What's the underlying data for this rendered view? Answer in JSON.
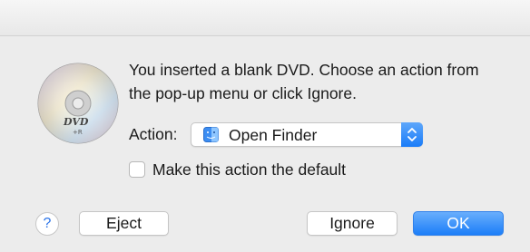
{
  "dialog": {
    "message": "You inserted a blank DVD. Choose an action from the pop-up menu or click Ignore.",
    "disc_label": "DVD",
    "disc_sublabel": "+R",
    "action_label": "Action:",
    "action_value": "Open Finder",
    "checkbox_label": "Make this action the default",
    "checkbox_checked": false,
    "help_label": "?",
    "eject_label": "Eject",
    "ignore_label": "Ignore",
    "ok_label": "OK"
  },
  "colors": {
    "accent": "#1c7ef8",
    "background": "#ececec"
  },
  "icons": {
    "disc": "dvd-disc-icon",
    "app": "finder-icon",
    "popup": "chevron-up-down-icon"
  }
}
